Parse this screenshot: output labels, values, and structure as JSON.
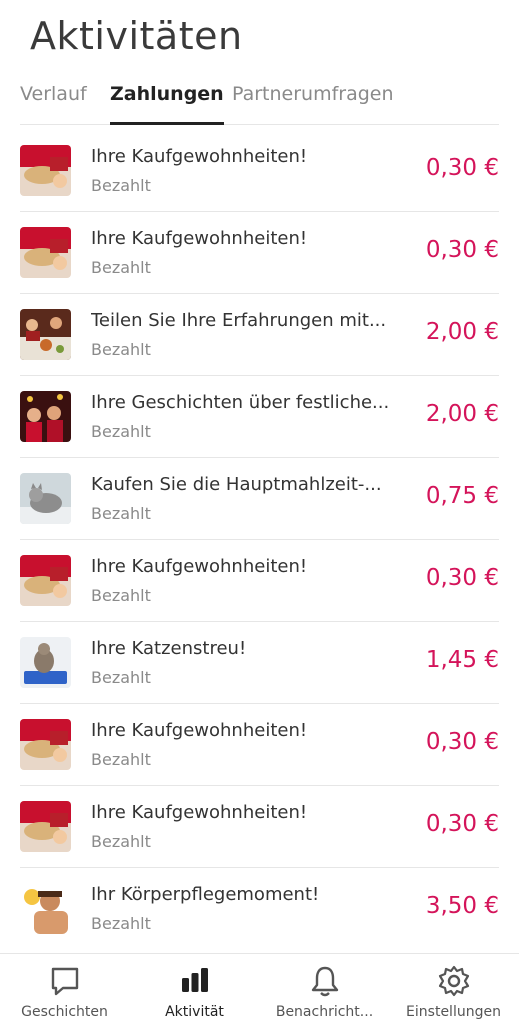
{
  "header": {
    "title": "Aktivitäten"
  },
  "tabs": [
    {
      "label": "Verlauf"
    },
    {
      "label": "Zahlungen",
      "active": true
    },
    {
      "label": "Partnerumfragen"
    }
  ],
  "payments": [
    {
      "title": "Ihre Kaufgewohnheiten!",
      "status": "Bezahlt",
      "amount": "0,30 €",
      "icon": "shopping-photo"
    },
    {
      "title": "Ihre Kaufgewohnheiten!",
      "status": "Bezahlt",
      "amount": "0,30 €",
      "icon": "shopping-photo"
    },
    {
      "title": "Teilen Sie Ihre Erfahrungen mit...",
      "status": "Bezahlt",
      "amount": "2,00 €",
      "icon": "dinner-photo"
    },
    {
      "title": "Ihre Geschichten über festliche...",
      "status": "Bezahlt",
      "amount": "2,00 €",
      "icon": "party-photo"
    },
    {
      "title": "Kaufen Sie die Hauptmahlzeit-...",
      "status": "Bezahlt",
      "amount": "0,75 €",
      "icon": "cat-photo"
    },
    {
      "title": "Ihre Kaufgewohnheiten!",
      "status": "Bezahlt",
      "amount": "0,30 €",
      "icon": "shopping-photo"
    },
    {
      "title": "Ihre Katzenstreu!",
      "status": "Bezahlt",
      "amount": "1,45 €",
      "icon": "cat-litter-photo"
    },
    {
      "title": "Ihre Kaufgewohnheiten!",
      "status": "Bezahlt",
      "amount": "0,30 €",
      "icon": "shopping-photo"
    },
    {
      "title": "Ihre Kaufgewohnheiten!",
      "status": "Bezahlt",
      "amount": "0,30 €",
      "icon": "shopping-photo"
    },
    {
      "title": "Ihr Körperpflegemoment!",
      "status": "Bezahlt",
      "amount": "3,50 €",
      "icon": "personal-care-photo"
    }
  ],
  "bottom_nav": [
    {
      "label": "Geschichten",
      "icon": "chat-bubble-icon"
    },
    {
      "label": "Aktivität",
      "icon": "bar-chart-icon",
      "active": true
    },
    {
      "label": "Benachricht...",
      "icon": "bell-icon"
    },
    {
      "label": "Einstellungen",
      "icon": "gear-icon"
    }
  ],
  "colors": {
    "accent": "#d4145a",
    "text": "#333333",
    "muted": "#8a8a8a",
    "divider": "#e6e6e6"
  }
}
